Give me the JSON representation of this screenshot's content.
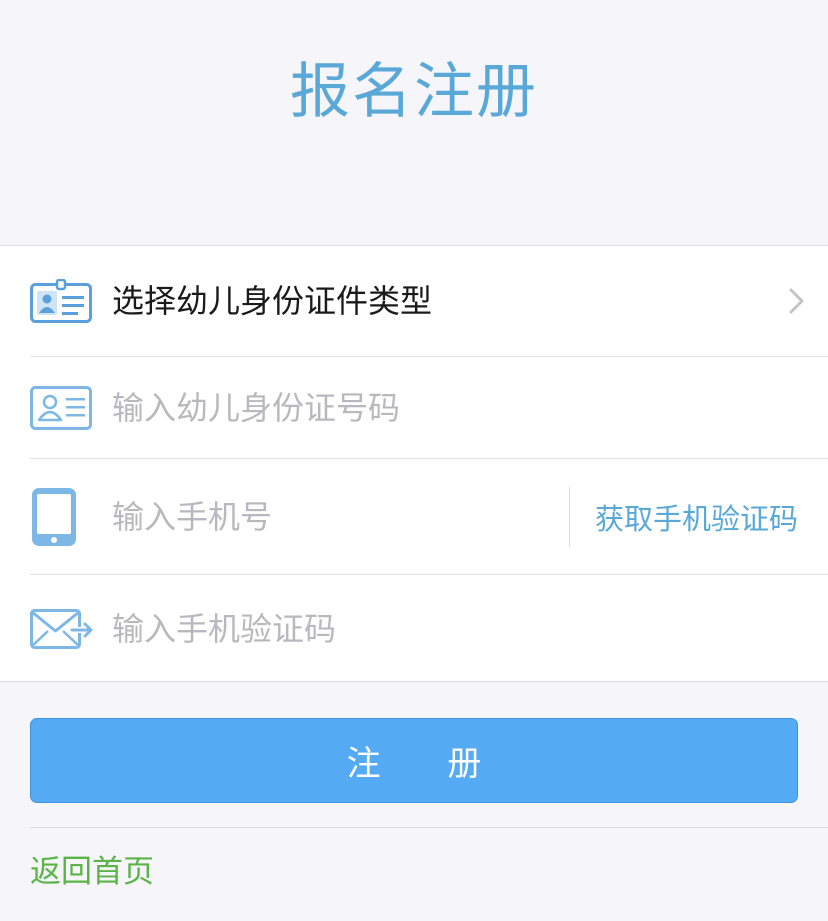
{
  "header": {
    "title": "报名注册"
  },
  "form": {
    "id_type": {
      "label": "选择幼儿身份证件类型",
      "icon": "id-badge-icon"
    },
    "id_number": {
      "placeholder": "输入幼儿身份证号码",
      "value": "",
      "icon": "id-card-icon"
    },
    "phone": {
      "placeholder": "输入手机号",
      "value": "",
      "icon": "mobile-phone-icon",
      "get_code_label": "获取手机验证码"
    },
    "code": {
      "placeholder": "输入手机验证码",
      "value": "",
      "icon": "envelope-icon"
    }
  },
  "actions": {
    "register_label": "注 册",
    "back_home_label": "返回首页"
  },
  "colors": {
    "accent": "#59a8d8",
    "button": "#54aaf3",
    "link_green": "#5ab448",
    "placeholder": "#b8b8be"
  }
}
